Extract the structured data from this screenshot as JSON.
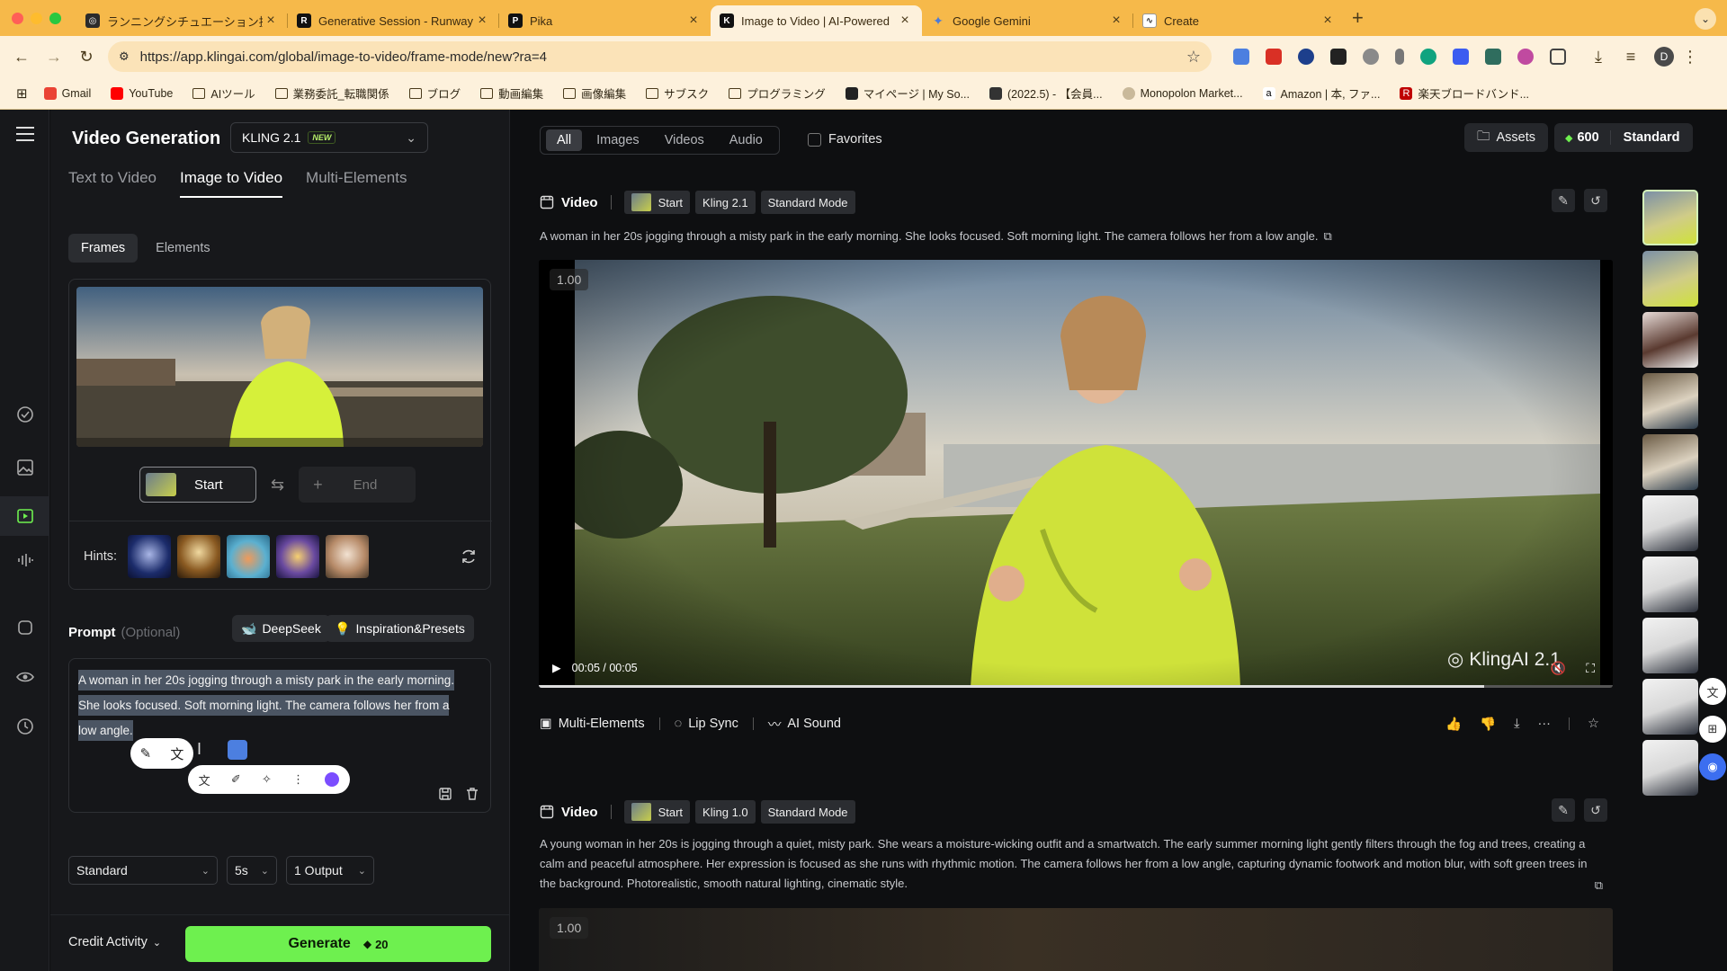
{
  "browser": {
    "tabs": [
      {
        "title": "ランニングシチュエーション提案",
        "active": false
      },
      {
        "title": "Generative Session - Runway",
        "active": false
      },
      {
        "title": "Pika",
        "active": false
      },
      {
        "title": "Image to Video | AI-Powered",
        "active": true
      },
      {
        "title": "Google Gemini",
        "active": false
      },
      {
        "title": "Create",
        "active": false
      }
    ],
    "url": "https://app.klingai.com/global/image-to-video/frame-mode/new?ra=4",
    "bookmarks": [
      "Gmail",
      "YouTube",
      "AIツール",
      "業務委託_転職関係",
      "ブログ",
      "動画編集",
      "画像編集",
      "サブスク",
      "プログラミング",
      "マイページ | My So...",
      "(2022.5) - 【会員...",
      "Monopolon Market...",
      "Amazon | 本, ファ...",
      "楽天ブロードバンド..."
    ],
    "avatar_letter": "D"
  },
  "app": {
    "title": "Video Generation",
    "model": "KLING 2.1",
    "model_badge": "NEW",
    "mode_tabs": [
      "Text to Video",
      "Image to Video",
      "Multi-Elements"
    ],
    "sub_tabs": [
      "Frames",
      "Elements"
    ],
    "start_label": "Start",
    "end_label": "End",
    "hints_label": "Hints:",
    "prompt_label": "Prompt",
    "prompt_optional": "(Optional)",
    "deepseek_label": "DeepSeek",
    "inspiration_label": "Inspiration&Presets",
    "prompt_text": "A woman in her 20s jogging through a misty park in the early morning. She looks focused. Soft morning light. The camera follows her from a low angle.",
    "quality": "Standard",
    "duration": "5s",
    "outputs": "1 Output",
    "credit_activity": "Credit Activity",
    "generate_label": "Generate",
    "generate_cost": "20"
  },
  "main": {
    "filters": [
      "All",
      "Images",
      "Videos",
      "Audio"
    ],
    "favorites_label": "Favorites",
    "assets_label": "Assets",
    "credits": "600",
    "plan": "Standard",
    "cards": [
      {
        "type": "Video",
        "chips": [
          "Start",
          "Kling 2.1",
          "Standard Mode"
        ],
        "description": "A woman in her 20s jogging through a misty park in the early morning. She looks focused. Soft morning light. The camera follows her from a low angle.",
        "zoom": "1.00",
        "time": "00:05 / 00:05",
        "progress": 0.88,
        "watermark": "KlingAI 2.1",
        "actions": [
          "Multi-Elements",
          "Lip Sync",
          "AI Sound"
        ]
      },
      {
        "type": "Video",
        "chips": [
          "Start",
          "Kling 1.0",
          "Standard Mode"
        ],
        "description": "A young woman in her 20s is jogging through a quiet, misty park. She wears a moisture-wicking outfit and a smartwatch. The early summer morning light gently filters through the fog and trees, creating a calm and peaceful atmosphere. Her expression is focused as she runs with rhythmic motion. The camera follows her from a low angle, capturing dynamic footwork and motion blur, with soft green trees in the background. Photorealistic, smooth natural lighting, cinematic style.",
        "zoom": "1.00"
      }
    ]
  },
  "colors": {
    "accent_green": "#6ef04f",
    "browser_chrome": "#f6b94a",
    "app_bg": "#0e0f11",
    "panel_bg": "#17181b"
  }
}
